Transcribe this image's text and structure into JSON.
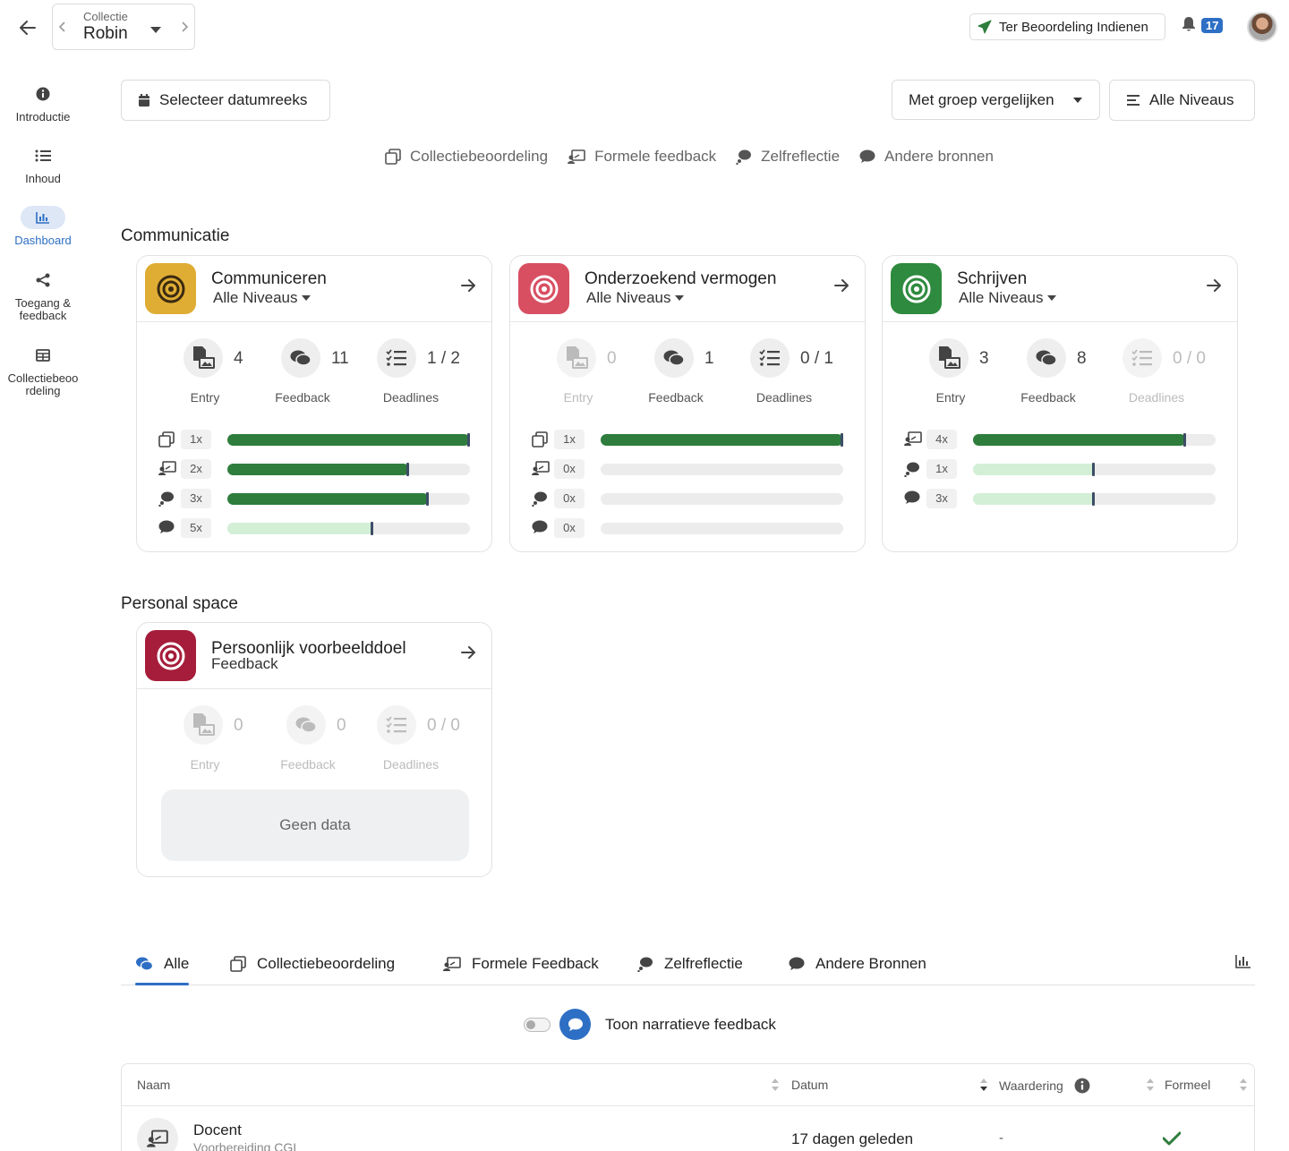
{
  "header": {
    "collection_label": "Collectie",
    "collection_value": "Robin",
    "submit_label": "Ter Beoordeling Indienen",
    "notification_count": "17"
  },
  "sidebar": {
    "items": [
      {
        "label": "Introductie",
        "icon": "info-icon"
      },
      {
        "label": "Inhoud",
        "icon": "list-icon"
      },
      {
        "label": "Dashboard",
        "icon": "chart-icon"
      },
      {
        "label": "Toegang & feedback",
        "icon": "share-icon"
      },
      {
        "label": "Collectiebeoordeling",
        "icon": "table-icon"
      }
    ]
  },
  "toolbar": {
    "date_range_label": "Selecteer datumreeks",
    "compare_label": "Met groep vergelijken",
    "levels_label": "Alle Niveaus"
  },
  "legend": [
    {
      "label": "Collectiebeoordeling",
      "icon": "copy-icon"
    },
    {
      "label": "Formele feedback",
      "icon": "teacher-icon"
    },
    {
      "label": "Zelfreflectie",
      "icon": "thought-icon"
    },
    {
      "label": "Andere bronnen",
      "icon": "comment-icon"
    }
  ],
  "sections": {
    "communicatie": "Communicatie",
    "personal": "Personal space"
  },
  "captions": {
    "entry": "Entry",
    "feedback": "Feedback",
    "deadlines": "Deadlines"
  },
  "cards": [
    {
      "title": "Communiceren",
      "subtitle": "Alle Niveaus",
      "color": "#e0ad34",
      "stats": {
        "entry": "4",
        "feedback": "11",
        "deadlines": "1 / 2"
      },
      "dims": {
        "entry": false,
        "feedback": false,
        "deadlines": false
      },
      "bars": [
        {
          "icon": "copy-icon",
          "count": "1x",
          "value": 1.0,
          "tone": "dark"
        },
        {
          "icon": "teacher-icon",
          "count": "2x",
          "value": 0.75,
          "tone": "dark"
        },
        {
          "icon": "thought-icon",
          "count": "3x",
          "value": 0.83,
          "tone": "dark"
        },
        {
          "icon": "comment-icon",
          "count": "5x",
          "value": 0.6,
          "tone": "light"
        }
      ]
    },
    {
      "title": "Onderzoekend vermogen",
      "subtitle": "Alle Niveaus",
      "color": "#d84f62",
      "stats": {
        "entry": "0",
        "feedback": "1",
        "deadlines": "0 / 1"
      },
      "dims": {
        "entry": true,
        "feedback": false,
        "deadlines": false
      },
      "bars": [
        {
          "icon": "copy-icon",
          "count": "1x",
          "value": 1.0,
          "tone": "dark"
        },
        {
          "icon": "teacher-icon",
          "count": "0x",
          "value": 0,
          "tone": "none"
        },
        {
          "icon": "thought-icon",
          "count": "0x",
          "value": 0,
          "tone": "none"
        },
        {
          "icon": "comment-icon",
          "count": "0x",
          "value": 0,
          "tone": "none"
        }
      ]
    },
    {
      "title": "Schrijven",
      "subtitle": "Alle Niveaus",
      "color": "#2e8a3e",
      "stats": {
        "entry": "3",
        "feedback": "8",
        "deadlines": "0 / 0"
      },
      "dims": {
        "entry": false,
        "feedback": false,
        "deadlines": true
      },
      "bars": [
        {
          "icon": "teacher-icon",
          "count": "4x",
          "value": 0.88,
          "tone": "dark"
        },
        {
          "icon": "thought-icon",
          "count": "1x",
          "value": 0.5,
          "tone": "light"
        },
        {
          "icon": "comment-icon",
          "count": "3x",
          "value": 0.5,
          "tone": "light"
        }
      ]
    }
  ],
  "personal_card": {
    "title": "Persoonlijk voorbeelddoel",
    "subtitle": "Feedback",
    "color": "#a51d3a",
    "stats": {
      "entry": "0",
      "feedback": "0",
      "deadlines": "0 / 0"
    },
    "no_data": "Geen data"
  },
  "tabs": [
    {
      "label": "Alle",
      "icon": "comments-icon",
      "active": true
    },
    {
      "label": "Collectiebeoordeling",
      "icon": "copy-icon"
    },
    {
      "label": "Formele Feedback",
      "icon": "teacher-icon"
    },
    {
      "label": "Zelfreflectie",
      "icon": "thought-icon"
    },
    {
      "label": "Andere Bronnen",
      "icon": "comment-icon"
    }
  ],
  "narrative_toggle_label": "Toon narratieve feedback",
  "table": {
    "headers": {
      "name": "Naam",
      "date": "Datum",
      "rating": "Waardering",
      "formal": "Formeel"
    },
    "rows": [
      {
        "name": "Docent",
        "sub": "Voorbereiding CGI",
        "date": "17 dagen geleden",
        "rating": "-",
        "formal": true
      }
    ]
  },
  "colors": {
    "accent": "#2d6fc4",
    "bar_dark": "#2e7d3c",
    "bar_light": "#d3efd6"
  }
}
